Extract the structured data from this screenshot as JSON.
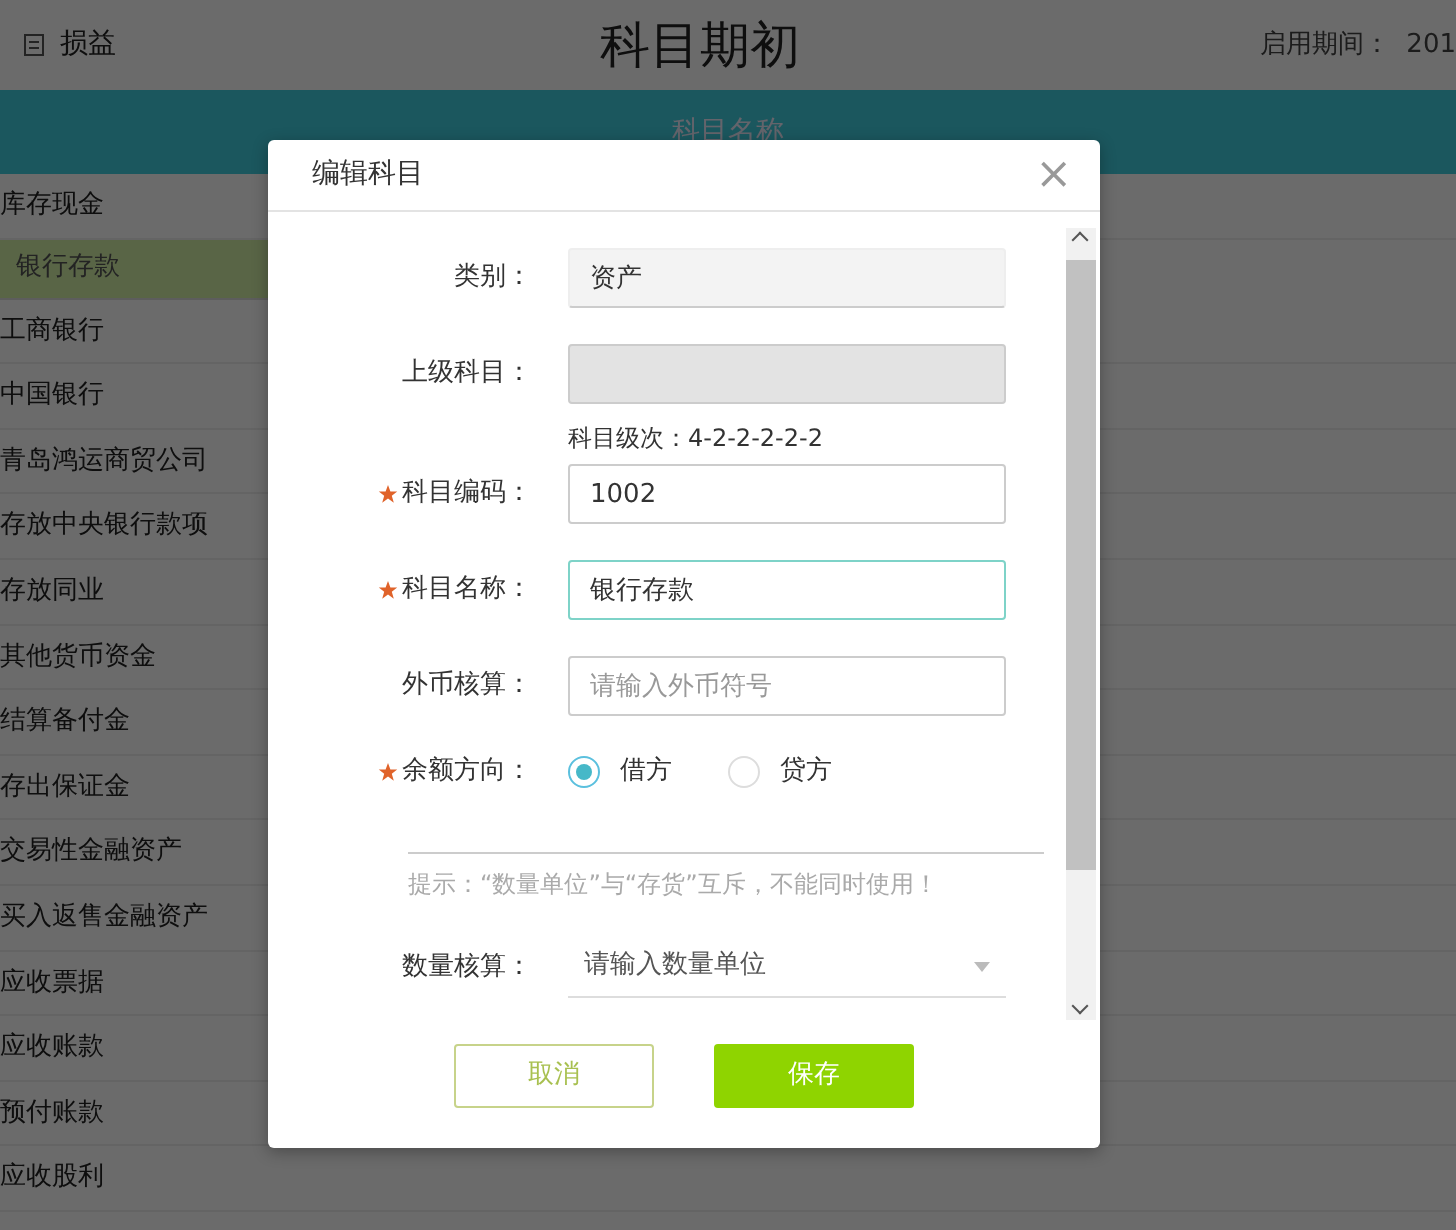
{
  "header": {
    "tab_label": "损益",
    "title": "科目期初",
    "period_label": "启用期间：",
    "period_value": "201"
  },
  "table": {
    "column": "科目名称",
    "rows": [
      {
        "name": "库存现金",
        "selected": false
      },
      {
        "name": "银行存款",
        "selected": true
      },
      {
        "name": "工商银行",
        "selected": false
      },
      {
        "name": "中国银行",
        "selected": false
      },
      {
        "name": "青岛鸿运商贸公司",
        "selected": false
      },
      {
        "name": "存放中央银行款项",
        "selected": false
      },
      {
        "name": "存放同业",
        "selected": false
      },
      {
        "name": "其他货币资金",
        "selected": false
      },
      {
        "name": "结算备付金",
        "selected": false
      },
      {
        "name": "存出保证金",
        "selected": false
      },
      {
        "name": "交易性金融资产",
        "selected": false
      },
      {
        "name": "买入返售金融资产",
        "selected": false
      },
      {
        "name": "应收票据",
        "selected": false
      },
      {
        "name": "应收账款",
        "selected": false
      },
      {
        "name": "预付账款",
        "selected": false
      },
      {
        "name": "应收股利",
        "selected": false
      }
    ]
  },
  "dialog": {
    "title": "编辑科目",
    "close": "×",
    "fields": [
      {
        "kind": "input",
        "label": "类别：",
        "value": "资产",
        "disabled": true,
        "required": false,
        "focused": false
      },
      {
        "kind": "input",
        "label": "上级科目：",
        "disabled": true,
        "required": false,
        "focused": false
      },
      {
        "kind": "note",
        "text": "科目级次：4-2-2-2-2-2"
      },
      {
        "kind": "input",
        "label": "科目编码：",
        "value": "1002",
        "disabled": false,
        "required": true,
        "focused": false
      },
      {
        "kind": "input",
        "label": "科目名称：",
        "value": "银行存款",
        "disabled": false,
        "required": true,
        "focused": true
      },
      {
        "kind": "input",
        "label": "外币核算：",
        "placeholder": "请输入外币符号",
        "disabled": false,
        "required": false,
        "focused": false
      },
      {
        "kind": "radio",
        "label": "余额方向：",
        "required": true,
        "options": [
          {
            "label": "借方",
            "selected": true
          },
          {
            "label": "贷方",
            "selected": false
          }
        ]
      },
      {
        "kind": "hint",
        "text": "提示：“数量单位”与“存货”互斥，不能同时使用！"
      },
      {
        "kind": "select",
        "label": "数量核算：",
        "placeholder": "请输入数量单位",
        "required": false
      }
    ],
    "buttons": [
      {
        "label": "取消",
        "kind": "secondary"
      },
      {
        "label": "保存",
        "kind": "primary"
      }
    ]
  }
}
